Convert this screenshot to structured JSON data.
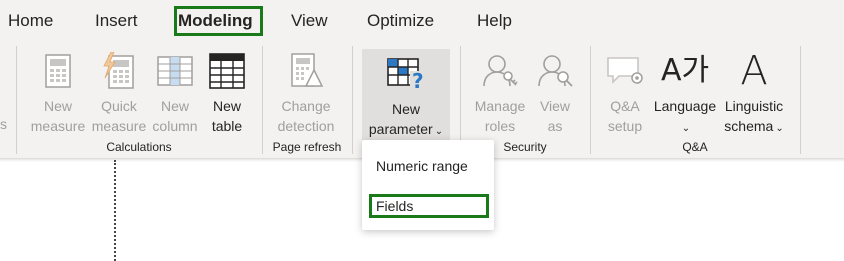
{
  "tabs": [
    {
      "label": "Home"
    },
    {
      "label": "Insert"
    },
    {
      "label": "Modeling"
    },
    {
      "label": "View"
    },
    {
      "label": "Optimize"
    },
    {
      "label": "Help"
    }
  ],
  "active_tab": "Modeling",
  "highlight_color": "#1a7a1a",
  "ribbon": {
    "partial_left_label": "s",
    "calculations": {
      "group_label": "Calculations",
      "new_measure": {
        "line1": "New",
        "line2": "measure"
      },
      "quick_measure": {
        "line1": "Quick",
        "line2": "measure"
      },
      "new_column": {
        "line1": "New",
        "line2": "column"
      },
      "new_table": {
        "line1": "New",
        "line2": "table"
      }
    },
    "page_refresh": {
      "group_label": "Page refresh",
      "change_detection": {
        "line1": "Change",
        "line2": "detection"
      }
    },
    "parameters": {
      "new_parameter": {
        "line1": "New",
        "line2": "parameter"
      }
    },
    "security": {
      "group_label": "Security",
      "manage_roles": {
        "line1": "Manage",
        "line2": "roles"
      },
      "view_as": {
        "line1": "View",
        "line2": "as"
      }
    },
    "qa": {
      "group_label": "Q&A",
      "qa_setup": {
        "line1": "Q&A",
        "line2": "setup"
      },
      "language": {
        "line1": "Language",
        "glyph": "A가"
      },
      "linguistic_schema": {
        "line1": "Linguistic",
        "line2": "schema",
        "glyph": "A"
      }
    }
  },
  "dropdown": {
    "items": [
      {
        "label": "Numeric range"
      },
      {
        "label": "Fields"
      }
    ]
  }
}
